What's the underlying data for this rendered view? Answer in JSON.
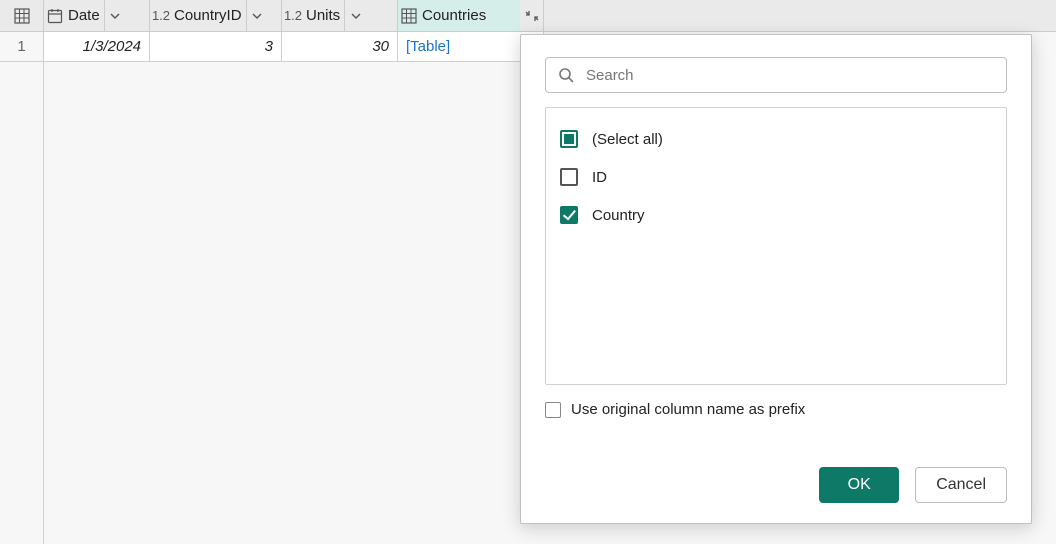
{
  "columns": {
    "date": {
      "label": "Date"
    },
    "countryId": {
      "label": "CountryID"
    },
    "units": {
      "label": "Units"
    },
    "countries": {
      "label": "Countries"
    }
  },
  "row": {
    "index": "1",
    "date": "1/3/2024",
    "countryId": "3",
    "units": "30",
    "countries": "[Table]"
  },
  "popup": {
    "searchPlaceholder": "Search",
    "selectAll": "(Select all)",
    "options": {
      "id": {
        "label": "ID"
      },
      "country": {
        "label": "Country"
      }
    },
    "prefixLabel": "Use original column name as prefix",
    "ok": "OK",
    "cancel": "Cancel"
  }
}
